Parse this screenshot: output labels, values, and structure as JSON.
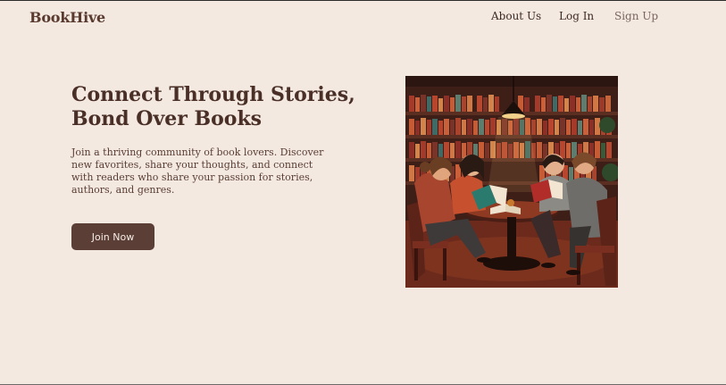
{
  "header": {
    "brand": "BookHive",
    "nav": {
      "about": "About Us",
      "login": "Log In",
      "signup": "Sign Up"
    }
  },
  "hero": {
    "title_line1": "Connect Through Stories,",
    "title_line2": "Bond Over Books",
    "description": "Join a thriving community of book lovers. Discover new favorites, share your thoughts, and connect with readers who share your passion for stories, authors, and genres.",
    "cta_label": "Join Now"
  },
  "colors": {
    "background": "#f3e9e1",
    "brand": "#5a3a2e",
    "button": "#5b3e35"
  }
}
